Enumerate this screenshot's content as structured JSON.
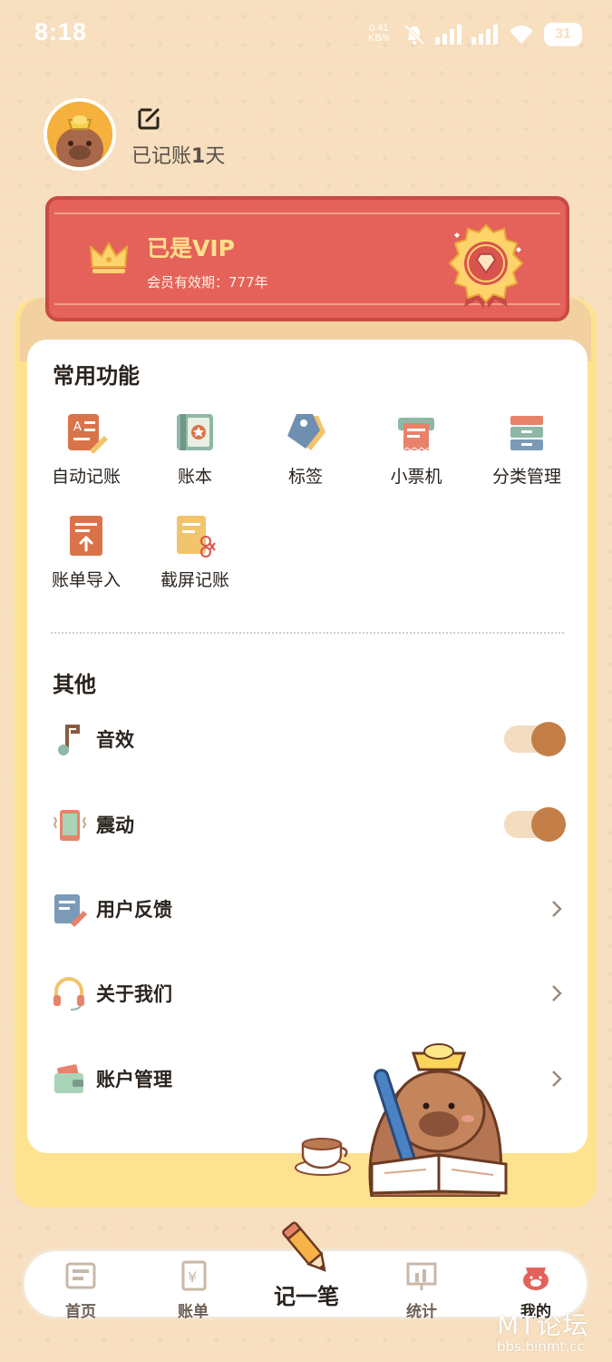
{
  "status_bar": {
    "time": "8:18",
    "net_speed_value": "0.41",
    "net_speed_unit": "KB/s",
    "battery": "31"
  },
  "profile": {
    "days_prefix": "已记账",
    "days_count": "1",
    "days_suffix": "天"
  },
  "vip": {
    "title": "已是VIP",
    "subtitle": "会员有效期：777年"
  },
  "common": {
    "title": "常用功能",
    "items": [
      {
        "label": "自动记账",
        "icon": "auto-bookkeeping-icon"
      },
      {
        "label": "账本",
        "icon": "ledger-icon"
      },
      {
        "label": "标签",
        "icon": "tag-icon"
      },
      {
        "label": "小票机",
        "icon": "receipt-printer-icon"
      },
      {
        "label": "分类管理",
        "icon": "category-drawer-icon"
      },
      {
        "label": "账单导入",
        "icon": "bill-import-icon"
      },
      {
        "label": "截屏记账",
        "icon": "screenshot-bookkeeping-icon"
      }
    ]
  },
  "other": {
    "title": "其他",
    "rows": [
      {
        "label": "音效",
        "icon": "music-note-icon",
        "type": "toggle",
        "on": true
      },
      {
        "label": "震动",
        "icon": "vibration-phone-icon",
        "type": "toggle",
        "on": true
      },
      {
        "label": "用户反馈",
        "icon": "feedback-note-icon",
        "type": "link"
      },
      {
        "label": "关于我们",
        "icon": "headset-icon",
        "type": "link"
      },
      {
        "label": "账户管理",
        "icon": "wallet-icon",
        "type": "link"
      }
    ]
  },
  "nav": {
    "items": [
      {
        "label": "首页",
        "icon": "home-icon"
      },
      {
        "label": "账单",
        "icon": "bill-icon"
      },
      {
        "label": "记一笔",
        "icon": "pencil-icon"
      },
      {
        "label": "统计",
        "icon": "chart-icon"
      },
      {
        "label": "我的",
        "icon": "capybara-profile-icon"
      }
    ]
  },
  "watermark": {
    "title": "MT论坛",
    "url": "bbs.binmt.cc"
  },
  "colors": {
    "background": "#f7dfbf",
    "vip_red": "#e4625a",
    "vip_gold": "#ffe08a",
    "card_yellow": "#fde38f",
    "toggle_knob": "#c47e47"
  }
}
